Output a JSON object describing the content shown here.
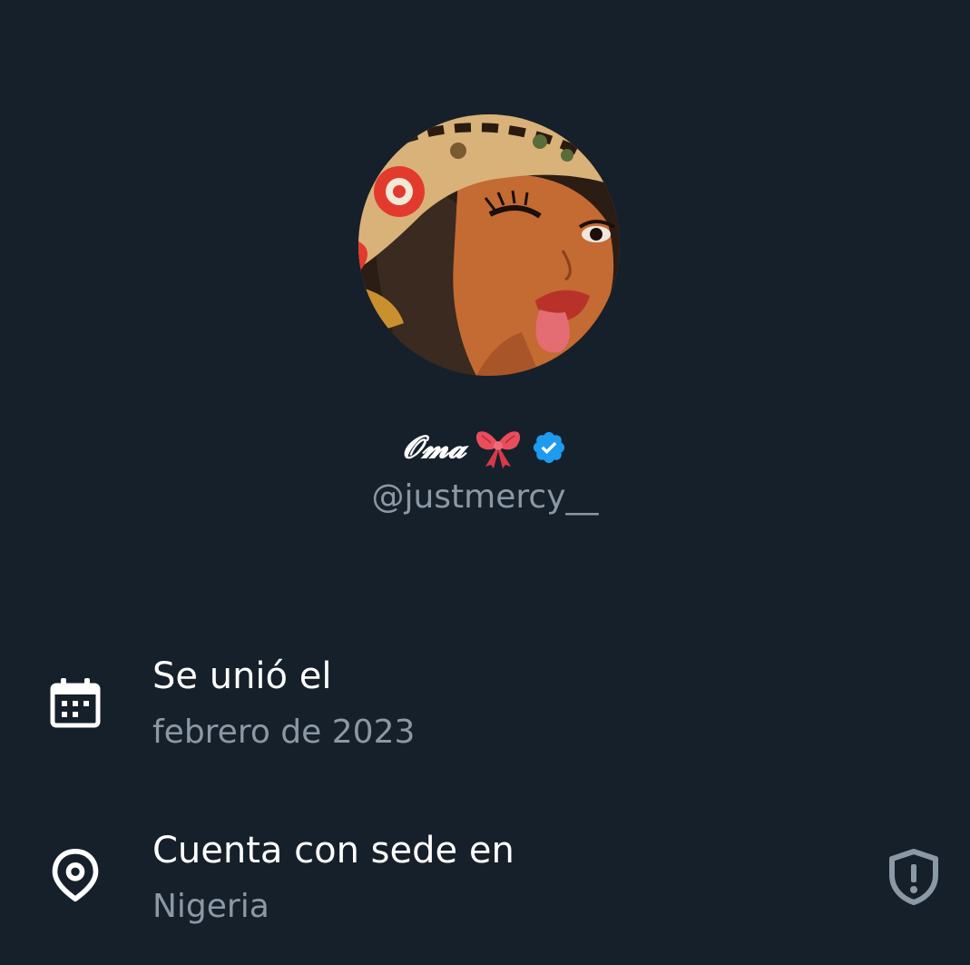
{
  "profile": {
    "display_name": "𝓞𝓶𝓪",
    "handle": "@justmercy__",
    "verified": true,
    "verified_color": "#1d9bf0",
    "name_emoji_icon": "ribbon-bow-icon"
  },
  "details": {
    "joined": {
      "title": "Se unió el",
      "value": "febrero de 2023",
      "icon": "calendar-icon"
    },
    "location": {
      "title": "Cuenta con sede en",
      "value": "Nigeria",
      "icon": "location-pin-icon",
      "trailing_icon": "shield-alert-icon"
    }
  },
  "colors": {
    "background": "#16202a",
    "primary_text": "#ffffff",
    "secondary_text": "#8b98a5",
    "accent": "#1d9bf0"
  }
}
